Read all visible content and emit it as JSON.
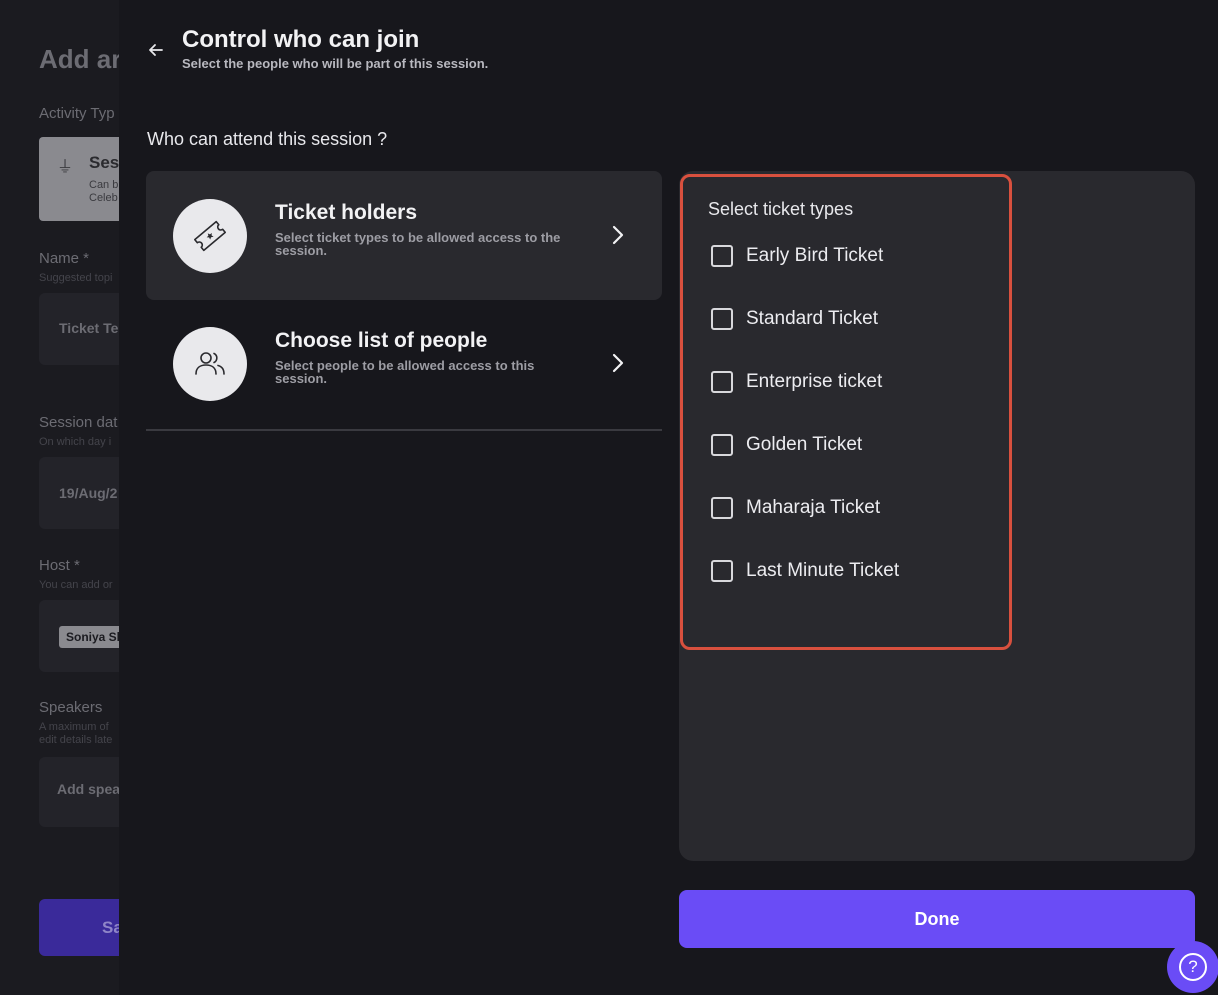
{
  "background_form": {
    "title": "Add ar",
    "activity_type_label": "Activity Typ",
    "activity_type": {
      "name": "Sess",
      "desc_line1": "Can b",
      "desc_line2": "Celeb"
    },
    "name_label": "Name *",
    "name_hint": "Suggested topi",
    "name_value": "Ticket Te",
    "session_date_label": "Session dat",
    "session_date_hint": "On which day i",
    "session_date_value": "19/Aug/2",
    "host_label": "Host *",
    "host_hint": "You can add or",
    "host_chip": "Soniya Sh",
    "speakers_label": "Speakers",
    "speakers_hint_line1": "A maximum of",
    "speakers_hint_line2": "edit details late",
    "speakers_placeholder": "Add spea",
    "save_label": "Sa"
  },
  "header": {
    "title": "Control who can join",
    "subtitle": "Select the people who will be part of this session."
  },
  "question": "Who can attend this session ?",
  "options": [
    {
      "title": "Ticket holders",
      "description": "Select ticket types to be allowed access to the session.",
      "icon": "ticket-icon",
      "active": true
    },
    {
      "title": "Choose list of people",
      "description": "Select people to be allowed access to this session.",
      "icon": "users-icon",
      "active": false
    }
  ],
  "ticket_panel": {
    "heading": "Select ticket types",
    "tickets": [
      {
        "label": "Early Bird Ticket",
        "checked": false
      },
      {
        "label": "Standard Ticket",
        "checked": false
      },
      {
        "label": "Enterprise ticket",
        "checked": false
      },
      {
        "label": "Golden Ticket",
        "checked": false
      },
      {
        "label": "Maharaja Ticket",
        "checked": false
      },
      {
        "label": "Last Minute Ticket",
        "checked": false
      }
    ]
  },
  "done_label": "Done",
  "help_label": "?",
  "colors": {
    "accent": "#6a4cf6",
    "highlight_border": "#d8503e",
    "panel": "#29292e",
    "background": "#17171c"
  }
}
